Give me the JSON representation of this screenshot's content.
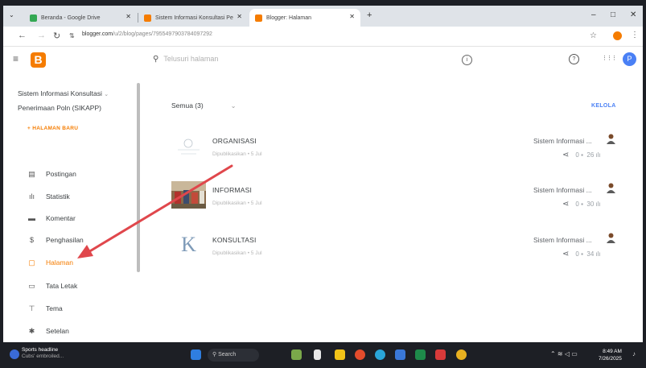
{
  "browser": {
    "tabs": [
      {
        "title": "Beranda - Google Drive",
        "color": "#34a853"
      },
      {
        "title": "Sistem Informasi Konsultasi Pe",
        "color": "#f57c00"
      },
      {
        "title": "Blogger: Halaman",
        "color": "#f57c00"
      }
    ],
    "new_tab": "+",
    "win_controls": [
      "–",
      "□",
      "✕"
    ],
    "url_host": "blogger.com",
    "url_path": "/u/2/blog/pages/7955497903784097292",
    "tab_close": "✕",
    "menu_dots": "⋮"
  },
  "app": {
    "logo_letter": "B",
    "search_placeholder": "Telusuri halaman",
    "avatar_letter": "P",
    "help_icon": "?",
    "info_icon": "i",
    "apps_icon": "⋮⋮⋮"
  },
  "sidebar": {
    "blog_name_line1": "Sistem Informasi Konsultasi",
    "blog_name_line2": "Penerimaan Poln (SIKAPP)",
    "new_page": "+  HALAMAN BARU",
    "items": [
      {
        "label": "Postingan",
        "icon": "▤"
      },
      {
        "label": "Statistik",
        "icon": "ılı"
      },
      {
        "label": "Komentar",
        "icon": "▬"
      },
      {
        "label": "Penghasilan",
        "icon": "$"
      },
      {
        "label": "Halaman",
        "icon": "▢"
      },
      {
        "label": "Tata Letak",
        "icon": "▭"
      },
      {
        "label": "Tema",
        "icon": "⊤"
      },
      {
        "label": "Setelan",
        "icon": "✱"
      }
    ]
  },
  "main": {
    "filter": "Semua (3)",
    "manage": "KELOLA",
    "pages": [
      {
        "title": "ORGANISASI",
        "meta": "Dipublikasikan • 5 Jul",
        "author": "Sistem Informasi ...",
        "comments": "0",
        "views": "26"
      },
      {
        "title": "INFORMASI",
        "meta": "Dipublikasikan • 5 Jul",
        "author": "Sistem Informasi ...",
        "comments": "0",
        "views": "30"
      },
      {
        "title": "KONSULTASI",
        "meta": "Dipublikasikan • 5 Jul",
        "author": "Sistem Informasi ...",
        "comments": "0",
        "views": "34"
      }
    ],
    "thumb_letter": "K"
  },
  "taskbar": {
    "weather_title": "Sports headline",
    "weather_sub": "Cubs' embroiled...",
    "search": "Search",
    "time": "8:49 AM",
    "date": "7/26/2025"
  },
  "colors": {
    "accent": "#f57c00",
    "link": "#4a80f5",
    "arrow": "#e0474c"
  }
}
